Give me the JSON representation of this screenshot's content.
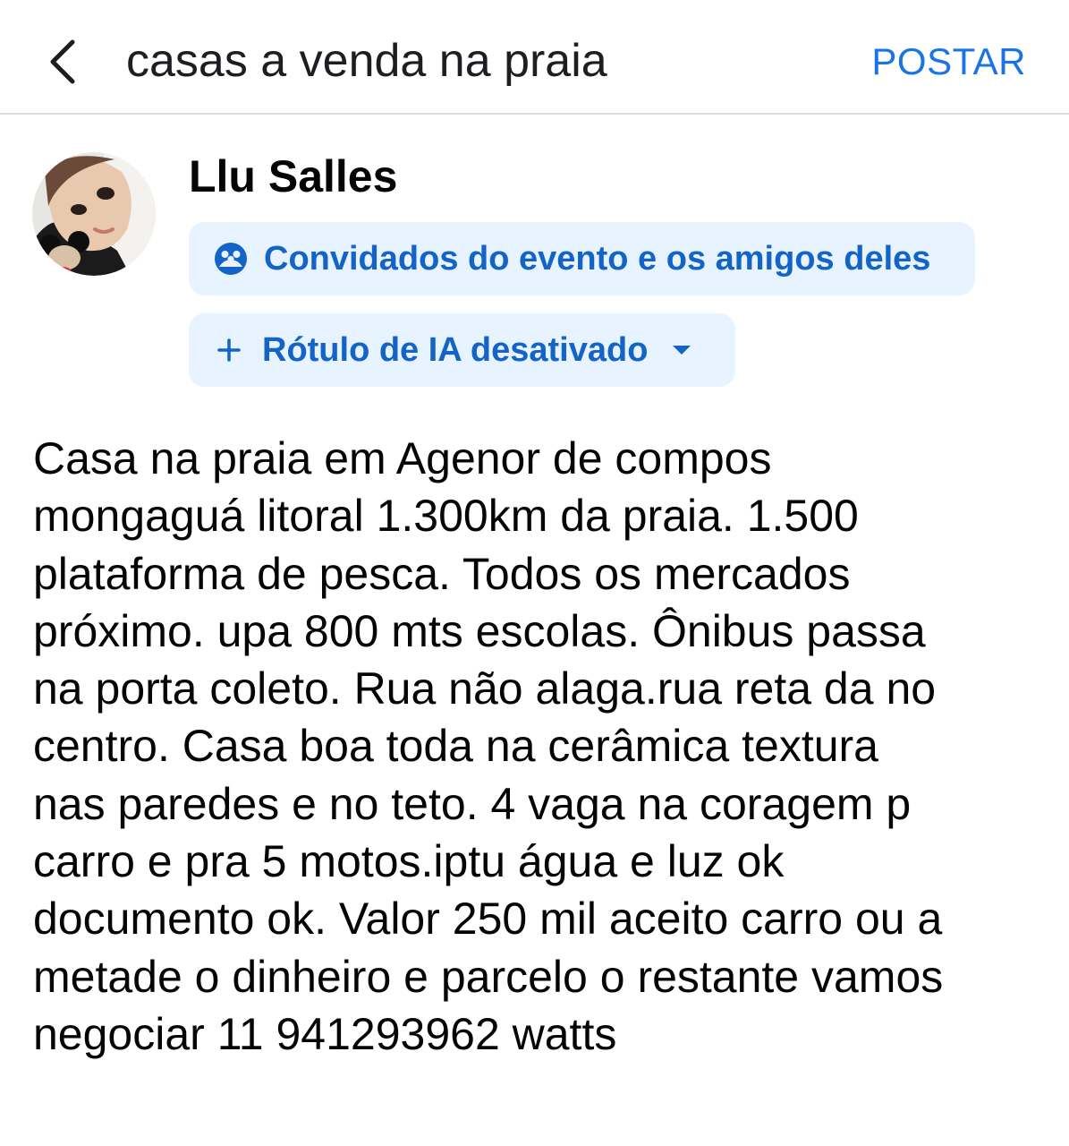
{
  "header": {
    "back_icon": "chevron-left-icon",
    "title": "casas a venda na praia",
    "post_label": "POSTAR",
    "accent_color": "#1b74e4"
  },
  "author": {
    "name": "Llu Salles",
    "avatar_icon": "profile-photo"
  },
  "audience": {
    "icon": "group-icon",
    "label": "Convidados do evento e os amigos deles"
  },
  "ai_label": {
    "icon": "plus-icon",
    "label": "Rótulo de IA desativado",
    "dropdown_icon": "caret-down-icon"
  },
  "post": {
    "text": "Casa na praia  em Agenor de compos\nmongaguá litoral 1.300km da praia. 1.500\nplataforma de pesca. Todos os mercados\npróximo. upa 800 mts escolas. Ônibus passa\nna porta coleto. Rua não alaga.rua reta da no\ncentro. Casa boa toda na cerâmica textura\nnas paredes e no teto. 4 vaga na coragem p\ncarro e pra 5 motos.iptu água e luz ok\ndocumento ok. Valor 250 mil aceito carro ou a\nmetade o dinheiro e parcelo o restante  vamos\nnegociar 11 941293962 watts"
  }
}
